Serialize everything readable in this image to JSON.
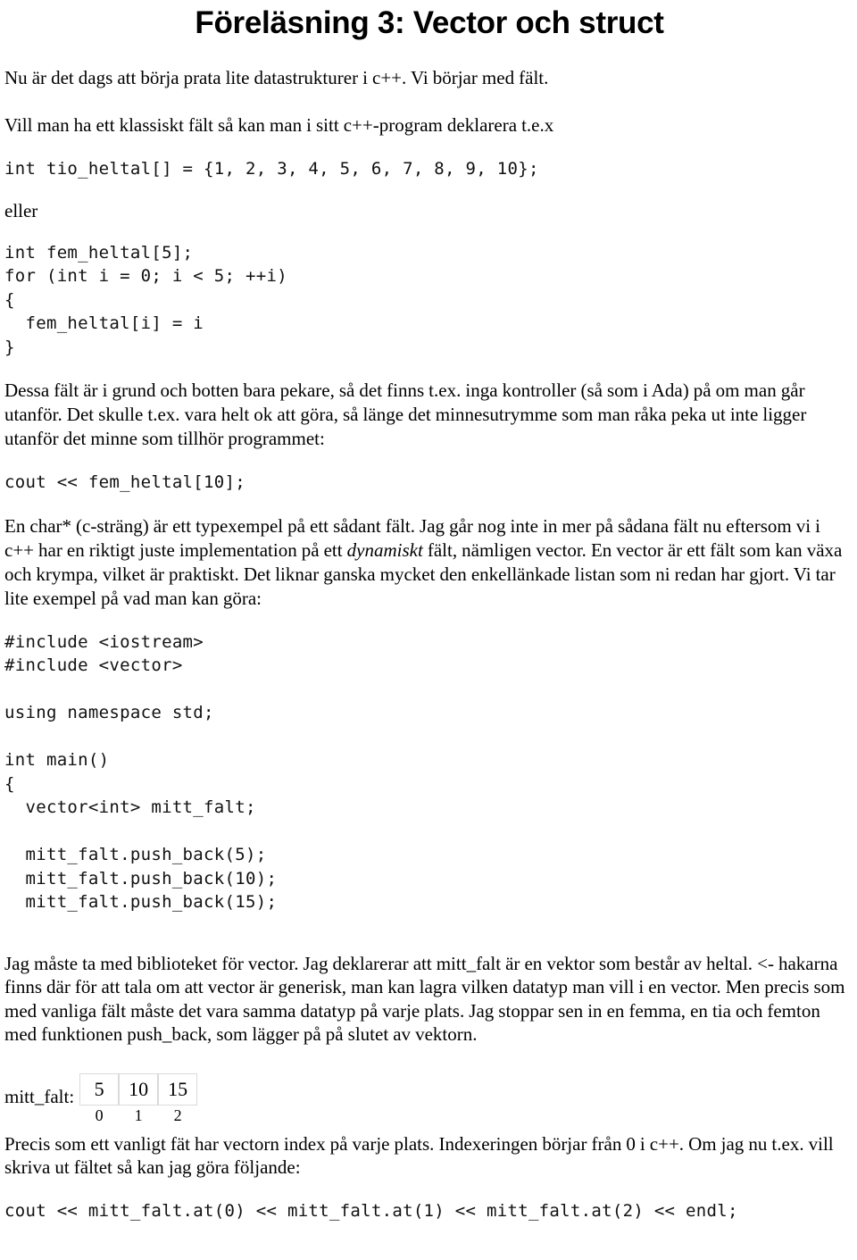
{
  "document": {
    "title": "Föreläsning 3: Vector och struct",
    "intro_paragraphs": [
      "Nu är det dags att börja prata lite datastrukturer i c++. Vi börjar med fält.",
      "Vill man ha ett klassiskt fält så kan man i sitt c++-program deklarera t.e.x"
    ],
    "code_blocks": {
      "tio_heltal": "int tio_heltal[] = {1, 2, 3, 4, 5, 6, 7, 8, 9, 10};",
      "eller_label": "eller",
      "fem_heltal_loop": "int fem_heltal[5];\nfor (int i = 0; i < 5; ++i)\n{\n  fem_heltal[i] = i\n}",
      "cout_fem_heltal": "cout << fem_heltal[10];",
      "vector_program": "#include <iostream>\n#include <vector>\n\nusing namespace std;\n\nint main()\n{\n  vector<int> mitt_falt;\n\n  mitt_falt.push_back(5);\n  mitt_falt.push_back(10);\n  mitt_falt.push_back(15);",
      "cout_at": "cout << mitt_falt.at(0) << mitt_falt.at(1) << mitt_falt.at(2) << endl;"
    },
    "paragraph_pointers": "Dessa fält är i grund och botten bara pekare, så det finns t.ex. inga kontroller (så som i Ada) på om man går utanför. Det skulle t.ex. vara helt ok att göra, så länge det minnesutrymme som man råka peka ut inte ligger utanför det minne som tillhör programmet:",
    "paragraph_charstar": {
      "part1": "En char* (c-sträng) är ett typexempel på ett sådant fält. Jag går nog inte in mer på sådana fält nu eftersom vi i c++ har en riktigt juste implementation på ett ",
      "emphasis": "dynamiskt",
      "part2": " fält, nämligen vector. En vector är ett fält som kan växa och krympa, vilket är praktiskt. Det liknar ganska mycket den enkellänkade listan som ni redan har gjort. Vi tar lite exempel på vad man kan göra:"
    },
    "paragraph_bibliotek": "Jag måste ta med biblioteket för vector. Jag deklarerar att mitt_falt är en vektor som består av heltal. <- hakarna finns där för att tala om att vector är generisk, man kan lagra vilken datatyp man vill i en vector. Men precis som med vanliga fält måste det vara samma datatyp på varje plats. Jag stoppar sen in en femma, en tia och femton med funktionen push_back, som lägger på på slutet av vektorn.",
    "paragraph_index": "Precis som ett vanligt fät har vectorn index på varje plats. Indexeringen börjar från 0 i c++. Om jag nu t.ex. vill skriva ut fältet så kan jag göra följande:",
    "array_diagram": {
      "label": "mitt_falt:",
      "values": [
        "5",
        "10",
        "15"
      ],
      "indices": [
        "0",
        "1",
        "2"
      ]
    }
  }
}
